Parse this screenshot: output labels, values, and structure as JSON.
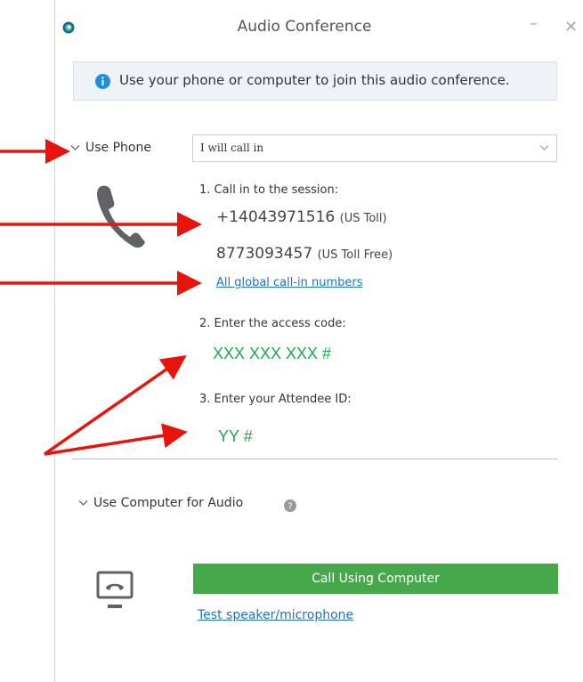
{
  "window": {
    "title": "Audio Conference",
    "minimize_glyph": "–",
    "close_glyph": "✕"
  },
  "info_banner": {
    "text": "Use your phone or computer to join this audio conference.",
    "icon": "info-icon"
  },
  "use_phone": {
    "label": "Use Phone",
    "select_value": "I will call in",
    "icon": "phone-icon",
    "step1_label": "1. Call in to the session:",
    "toll_number": "+14043971516",
    "toll_label": "(US Toll)",
    "tollfree_number": "8773093457",
    "tollfree_label": "(US Toll Free)",
    "global_link": "All global call-in numbers",
    "step2_label": "2. Enter the access code:",
    "access_code": "XXX XXX XXX #",
    "step3_label": "3. Enter your Attendee ID:",
    "attendee_id": "YY #"
  },
  "use_computer": {
    "label": "Use Computer for Audio",
    "call_button": "Call Using Computer",
    "test_link": "Test speaker/microphone",
    "icon": "computer-audio-icon"
  },
  "colors": {
    "green": "#1ca84a",
    "button_green": "#45a84a",
    "link_blue": "#1a73c8",
    "arrow_red": "#e8140c",
    "info_blue": "#1e8fe0"
  }
}
